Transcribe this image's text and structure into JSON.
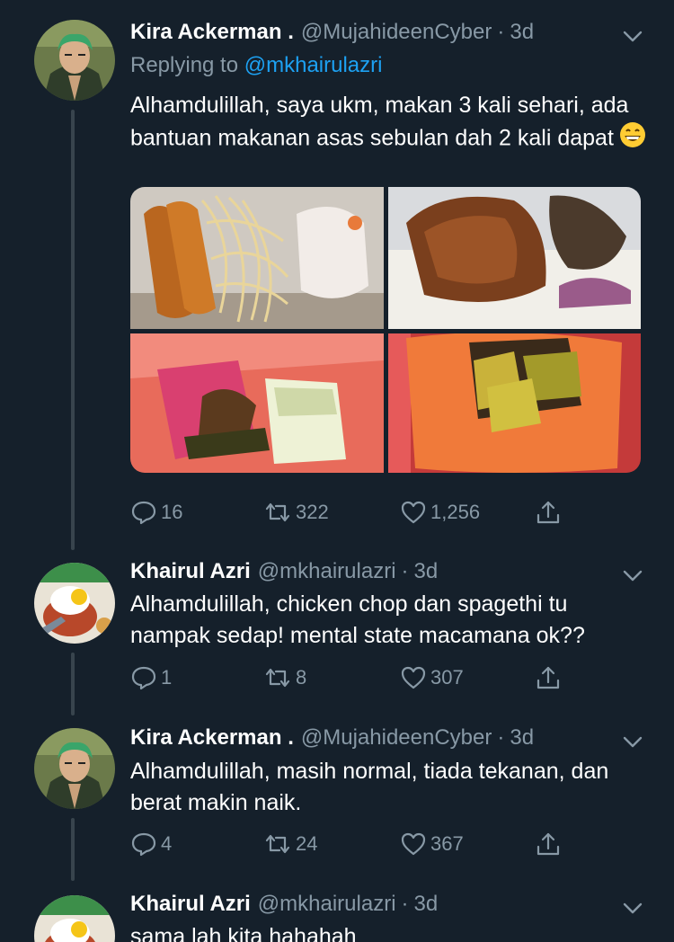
{
  "colors": {
    "background": "#15202b",
    "text": "#ffffff",
    "muted": "#8899a6",
    "link": "#1da1f2",
    "thread_line": "#38444d"
  },
  "tweets": [
    {
      "name": "Kira Ackerman .",
      "handle": "@MujahideenCyber",
      "separator": "·",
      "time": "3d",
      "replying_label": "Replying to ",
      "replying_to": "@mkhairulazri",
      "text": "Alhamdulillah, saya ukm, makan 3 kali sehari, ada bantuan makanan asas sebulan dah 2 kali dapat",
      "emoji_icon": "grinning-face-emoji",
      "media": [
        "chicken-chop-spaghetti-photo",
        "fried-chicken-rice-photo",
        "snacks-bag-photo",
        "chocolate-bag-photo"
      ],
      "replies": "16",
      "retweets": "322",
      "likes": "1,256"
    },
    {
      "name": "Khairul Azri",
      "handle": "@mkhairulazri",
      "separator": "·",
      "time": "3d",
      "text": "Alhamdulillah, chicken chop dan spagethi tu nampak sedap! mental state macamana ok??",
      "replies": "1",
      "retweets": "8",
      "likes": "307"
    },
    {
      "name": "Kira Ackerman .",
      "handle": "@MujahideenCyber",
      "separator": "·",
      "time": "3d",
      "text": "Alhamdulillah, masih normal, tiada tekanan, dan berat makin naik.",
      "replies": "4",
      "retweets": "24",
      "likes": "367"
    },
    {
      "name": "Khairul Azri",
      "handle": "@mkhairulazri",
      "separator": "·",
      "time": "3d",
      "text": "sama lah kita hahahah"
    }
  ]
}
